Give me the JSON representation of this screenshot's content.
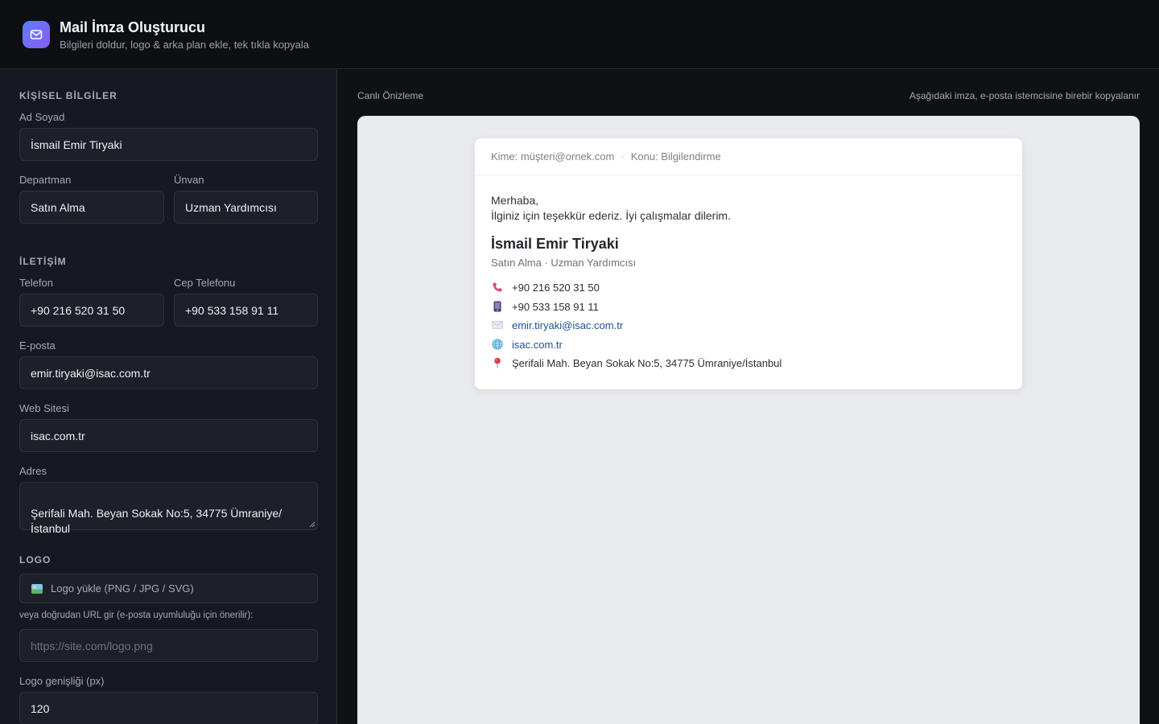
{
  "header": {
    "title": "Mail İmza Oluşturucu",
    "subtitle": "Bilgileri doldur, logo & arka plan ekle, tek tıkla kopyala",
    "accent_from": "#5b7cfa",
    "accent_to": "#8a5cf6",
    "icon": "mail-icon"
  },
  "form": {
    "personal": {
      "section_title": "KİŞİSEL BİLGİLER",
      "name_label": "Ad Soyad",
      "name_value": "İsmail Emir Tiryaki",
      "department_label": "Departman",
      "department_value": "Satın Alma",
      "title_label": "Ünvan",
      "title_value": "Uzman Yardımcısı"
    },
    "contact": {
      "section_title": "İLETİŞİM",
      "phone_label": "Telefon",
      "phone_value": "+90 216 520 31 50",
      "mobile_label": "Cep Telefonu",
      "mobile_value": "+90 533 158 91 11",
      "email_label": "E-posta",
      "email_value": "emir.tiryaki@isac.com.tr",
      "website_label": "Web Sitesi",
      "website_value": "isac.com.tr",
      "address_label": "Adres",
      "address_value": "Şerifali Mah. Beyan Sokak No:5, 34775 Ümraniye/\nİstanbul"
    },
    "logo": {
      "section_title": "LOGO",
      "upload_label": "Logo yükle (PNG / JPG / SVG)",
      "upload_icon": "image-icon",
      "url_hint": "veya doğrudan URL gir (e-posta uyumluluğu için önerilir):",
      "url_placeholder": "https://site.com/logo.png",
      "width_label": "Logo genişliği (px)",
      "width_value": "120"
    }
  },
  "preview": {
    "heading": "Canlı Önizleme",
    "note": "Aşağıdaki imza, e-posta istemcisine birebir kopyalanır",
    "meta_to": "Kime: müşteri@ornek.com",
    "meta_separator": "·",
    "meta_subject": "Konu: Bilgilendirme",
    "greeting_line1": "Merhaba,",
    "greeting_line2": "İlginiz için teşekkür ederiz. İyi çalışmalar dilerim.",
    "signature": {
      "name": "İsmail Emir Tiryaki",
      "role": "Satın Alma · Uzman Yardımcısı",
      "phone": "+90 216 520 31 50",
      "mobile": "+90 533 158 91 11",
      "email": "emir.tiryaki@isac.com.tr",
      "website": "isac.com.tr",
      "address": "Şerifali Mah. Beyan Sokak No:5, 34775 Ümraniye/İstanbul",
      "icons": [
        "phone-icon",
        "mobile-icon",
        "envelope-icon",
        "globe-icon",
        "pin-icon"
      ],
      "link_color": "#1f4f94"
    }
  }
}
